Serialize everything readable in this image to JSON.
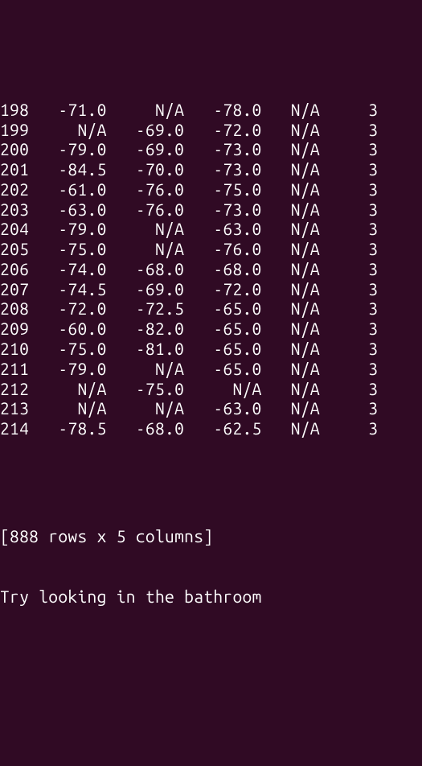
{
  "rows": [
    {
      "idx": "198",
      "c1": "-71.0",
      "c2": "N/A",
      "c3": "-78.0",
      "c4": "N/A",
      "c5": "3"
    },
    {
      "idx": "199",
      "c1": "N/A",
      "c2": "-69.0",
      "c3": "-72.0",
      "c4": "N/A",
      "c5": "3"
    },
    {
      "idx": "200",
      "c1": "-79.0",
      "c2": "-69.0",
      "c3": "-73.0",
      "c4": "N/A",
      "c5": "3"
    },
    {
      "idx": "201",
      "c1": "-84.5",
      "c2": "-70.0",
      "c3": "-73.0",
      "c4": "N/A",
      "c5": "3"
    },
    {
      "idx": "202",
      "c1": "-61.0",
      "c2": "-76.0",
      "c3": "-75.0",
      "c4": "N/A",
      "c5": "3"
    },
    {
      "idx": "203",
      "c1": "-63.0",
      "c2": "-76.0",
      "c3": "-73.0",
      "c4": "N/A",
      "c5": "3"
    },
    {
      "idx": "204",
      "c1": "-79.0",
      "c2": "N/A",
      "c3": "-63.0",
      "c4": "N/A",
      "c5": "3"
    },
    {
      "idx": "205",
      "c1": "-75.0",
      "c2": "N/A",
      "c3": "-76.0",
      "c4": "N/A",
      "c5": "3"
    },
    {
      "idx": "206",
      "c1": "-74.0",
      "c2": "-68.0",
      "c3": "-68.0",
      "c4": "N/A",
      "c5": "3"
    },
    {
      "idx": "207",
      "c1": "-74.5",
      "c2": "-69.0",
      "c3": "-72.0",
      "c4": "N/A",
      "c5": "3"
    },
    {
      "idx": "208",
      "c1": "-72.0",
      "c2": "-72.5",
      "c3": "-65.0",
      "c4": "N/A",
      "c5": "3"
    },
    {
      "idx": "209",
      "c1": "-60.0",
      "c2": "-82.0",
      "c3": "-65.0",
      "c4": "N/A",
      "c5": "3"
    },
    {
      "idx": "210",
      "c1": "-75.0",
      "c2": "-81.0",
      "c3": "-65.0",
      "c4": "N/A",
      "c5": "3"
    },
    {
      "idx": "211",
      "c1": "-79.0",
      "c2": "N/A",
      "c3": "-65.0",
      "c4": "N/A",
      "c5": "3"
    },
    {
      "idx": "212",
      "c1": "N/A",
      "c2": "-75.0",
      "c3": "N/A",
      "c4": "N/A",
      "c5": "3"
    },
    {
      "idx": "213",
      "c1": "N/A",
      "c2": "N/A",
      "c3": "-63.0",
      "c4": "N/A",
      "c5": "3"
    },
    {
      "idx": "214",
      "c1": "-78.5",
      "c2": "-68.0",
      "c3": "-62.5",
      "c4": "N/A",
      "c5": "3"
    }
  ],
  "footer": {
    "shape": "[888 rows x 5 columns]",
    "message": "Try looking in the bathroom"
  },
  "widths": {
    "idx": 3,
    "c1": 7,
    "c2": 7,
    "c3": 7,
    "c4": 5,
    "c5": 5
  }
}
